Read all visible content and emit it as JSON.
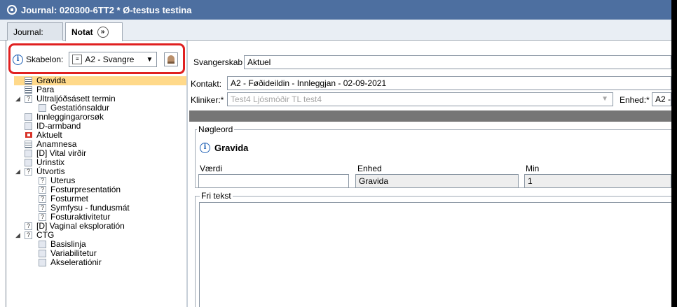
{
  "window": {
    "title": "Journal: 020300-6TT2 * Ø-testus testina"
  },
  "tabs": [
    {
      "label": "Journal:"
    },
    {
      "label": "Notat"
    }
  ],
  "skabelon": {
    "label": "Skabelon:",
    "value": "A2 - Svangre",
    "dropdown_arrow": "▼"
  },
  "tree": [
    {
      "label": "Gravida",
      "icon": "lines",
      "selected": true
    },
    {
      "label": "Para",
      "icon": "lines"
    },
    {
      "label": "Ultraljóðsásett termin",
      "icon": "question",
      "expander": "◢"
    },
    {
      "label": "Gestatiónsaldur",
      "icon": "box"
    },
    {
      "label": "Innleggingarorsøk",
      "icon": "box"
    },
    {
      "label": "ID-armband",
      "icon": "box"
    },
    {
      "label": "Aktuelt",
      "icon": "flag"
    },
    {
      "label": "Anamnesa",
      "icon": "lines"
    },
    {
      "label": "[D] Vital virðir",
      "icon": "box"
    },
    {
      "label": "Urinstix",
      "icon": "box"
    },
    {
      "label": "Útvortis",
      "icon": "question",
      "expander": "◢"
    },
    {
      "label": "Uterus",
      "icon": "question"
    },
    {
      "label": "Fosturpresentatión",
      "icon": "question"
    },
    {
      "label": "Fosturmet",
      "icon": "question"
    },
    {
      "label": "Symfysu - fundusmát",
      "icon": "question"
    },
    {
      "label": "Fosturaktivitetur",
      "icon": "question"
    },
    {
      "label": "[D] Vaginal eksploratión",
      "icon": "question"
    },
    {
      "label": "CTG",
      "icon": "question",
      "expander": "◢"
    },
    {
      "label": "Basislinja",
      "icon": "box"
    },
    {
      "label": "Variabilitetur",
      "icon": "box"
    },
    {
      "label": "Akseleratiónir",
      "icon": "box"
    }
  ],
  "form": {
    "svangerskab_label": "Svangerskab",
    "svangerskab_value": "Aktuel",
    "kontakt_label": "Kontakt:",
    "kontakt_value": "A2 - Føðideildin - Innleggjan -  02-09-2021",
    "kliniker_label": "Kliniker:*",
    "kliniker_value": "Test4 Ljósmóðir TL test4",
    "enhed_label": "Enhed:*",
    "enhed_value": "A2 -",
    "noegleord_legend": "Nøgleord",
    "noegleord_title": "Gravida",
    "vaerdi_label": "Værdi",
    "vaerdi_value": "",
    "enhed_col_label": "Enhed",
    "enhed_col_value": "Gravida",
    "min_label": "Min",
    "min_value": "1",
    "fritekst_legend": "Fri tekst"
  },
  "colors": {
    "titlebar": "#4d6fa0",
    "selected": "#ffd98a",
    "highlight_border": "#e02020"
  }
}
